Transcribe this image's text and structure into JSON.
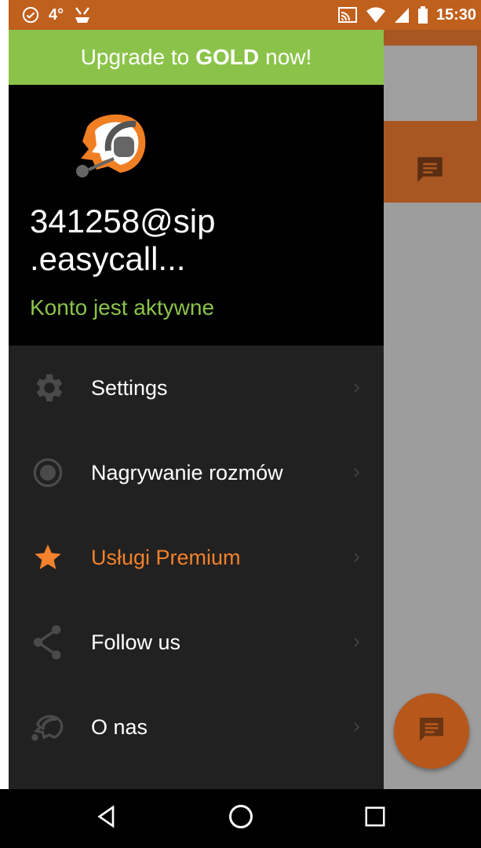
{
  "status_bar": {
    "temperature": "4°",
    "time": "15:30",
    "icons": [
      "check-circle-icon",
      "notification-icon",
      "cast-icon",
      "wifi-icon",
      "signal-icon",
      "battery-icon"
    ]
  },
  "drawer": {
    "upgrade": {
      "prefix": "Upgrade to",
      "highlight": "GOLD",
      "suffix": "now!"
    },
    "account": {
      "name": "341258@sip .easycall...",
      "status": "Konto jest aktywne"
    },
    "menu": [
      {
        "label": "Settings",
        "icon": "gear-icon"
      },
      {
        "label": "Nagrywanie rozmów",
        "icon": "record-icon"
      },
      {
        "label": "Usługi Premium",
        "icon": "star-icon"
      },
      {
        "label": "Follow us",
        "icon": "share-icon"
      },
      {
        "label": "O nas",
        "icon": "headset-icon"
      }
    ]
  },
  "colors": {
    "brand_orange": "#c0601d",
    "upgrade_green": "#8bc34a",
    "premium_orange": "#f4812b",
    "drawer_bg": "#212121"
  },
  "navbar": {
    "icons": [
      "back-icon",
      "home-icon",
      "recents-icon"
    ]
  }
}
